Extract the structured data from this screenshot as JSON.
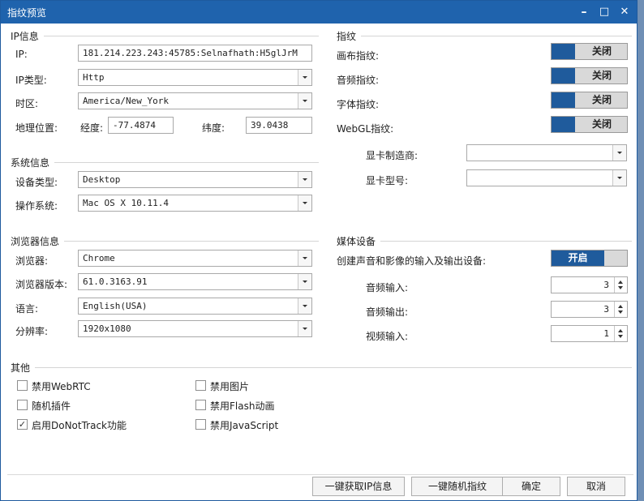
{
  "window": {
    "title": "指纹预览",
    "controls": {
      "minimize": "–",
      "maximize": "□",
      "close": "✕"
    }
  },
  "ip": {
    "section_title": "IP信息",
    "ip_label": "IP:",
    "ip_value": "181.214.223.243:45785:Selnafhath:H5glJrM",
    "type_label": "IP类型:",
    "type_value": "Http",
    "tz_label": "时区:",
    "tz_value": "America/New_York",
    "geo_label": "地理位置:",
    "lon_label": "经度:",
    "lon_value": "-77.4874",
    "lat_label": "纬度:",
    "lat_value": "39.0438"
  },
  "system": {
    "section_title": "系统信息",
    "device_label": "设备类型:",
    "device_value": "Desktop",
    "os_label": "操作系统:",
    "os_value": "Mac OS X 10.11.4"
  },
  "browser": {
    "section_title": "浏览器信息",
    "browser_label": "浏览器:",
    "browser_value": "Chrome",
    "version_label": "浏览器版本:",
    "version_value": "61.0.3163.91",
    "lang_label": "语言:",
    "lang_value": "English(USA)",
    "res_label": "分辨率:",
    "res_value": "1920x1080"
  },
  "other": {
    "section_title": "其他",
    "checkboxes": [
      {
        "label": "禁用WebRTC",
        "checked": false
      },
      {
        "label": "禁用图片",
        "checked": false
      },
      {
        "label": "随机插件",
        "checked": false
      },
      {
        "label": "禁用Flash动画",
        "checked": false
      },
      {
        "label": "启用DoNotTrack功能",
        "checked": true
      },
      {
        "label": "禁用JavaScript",
        "checked": false
      }
    ]
  },
  "fingerprint": {
    "section_title": "指纹",
    "canvas_label": "画布指纹:",
    "canvas_state": "关闭",
    "audio_label": "音频指纹:",
    "audio_state": "关闭",
    "font_label": "字体指纹:",
    "font_state": "关闭",
    "webgl_label": "WebGL指纹:",
    "webgl_state": "关闭",
    "gpu_vendor_label": "显卡制造商:",
    "gpu_vendor_value": "",
    "gpu_model_label": "显卡型号:",
    "gpu_model_value": ""
  },
  "media": {
    "section_title": "媒体设备",
    "create_label": "创建声音和影像的输入及输出设备:",
    "create_state": "开启",
    "audio_in_label": "音频输入:",
    "audio_in_value": "3",
    "audio_out_label": "音频输出:",
    "audio_out_value": "3",
    "video_in_label": "视频输入:",
    "video_in_value": "1"
  },
  "buttons": {
    "get_ip": "一键获取IP信息",
    "random_fp": "一键随机指纹",
    "ok": "确定",
    "cancel": "取消"
  },
  "colors": {
    "titlebar": "#1f63ad",
    "toggle_on": "#1f5b9c",
    "toggle_off_bg": "#d9d9d9"
  }
}
